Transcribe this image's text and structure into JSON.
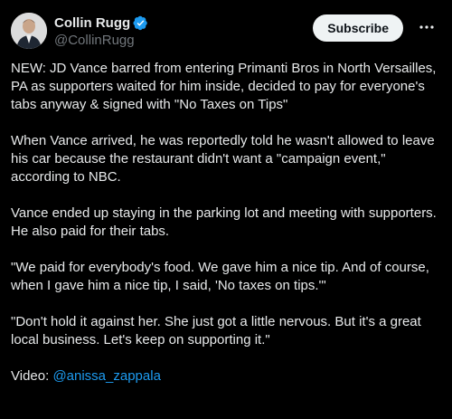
{
  "author": {
    "display_name": "Collin Rugg",
    "handle": "@CollinRugg",
    "verified": true,
    "avatar_icon": "avatar-photo"
  },
  "actions": {
    "subscribe_label": "Subscribe",
    "more_icon": "more-horizontal-icon"
  },
  "tweet": {
    "paragraphs": [
      "NEW: JD Vance barred from entering Primanti Bros in North Versailles, PA as supporters waited for him inside, decided to pay for everyone's tabs anyway & signed with \"No Taxes on Tips\"",
      "When Vance arrived, he was reportedly told he wasn't allowed to leave his car because the restaurant didn't want a \"campaign event,\" according to NBC.",
      "Vance ended up staying in the parking lot and meeting with supporters. He also paid for their tabs.",
      "\"We paid for everybody's food. We gave him a nice tip. And of course, when I gave him a nice tip, I said, 'No taxes on tips.'\"",
      "\"Don't hold it against her. She just got a little nervous. But it's a great local business. Let's keep on supporting it.\""
    ],
    "video_prefix": "Video: ",
    "video_credit": "@anissa_zappala"
  },
  "colors": {
    "background": "#000000",
    "text": "#e7e9ea",
    "secondary_text": "#71767b",
    "link": "#1d9bf0",
    "verified_badge": "#1d9bf0",
    "button_bg": "#eff3f4"
  }
}
